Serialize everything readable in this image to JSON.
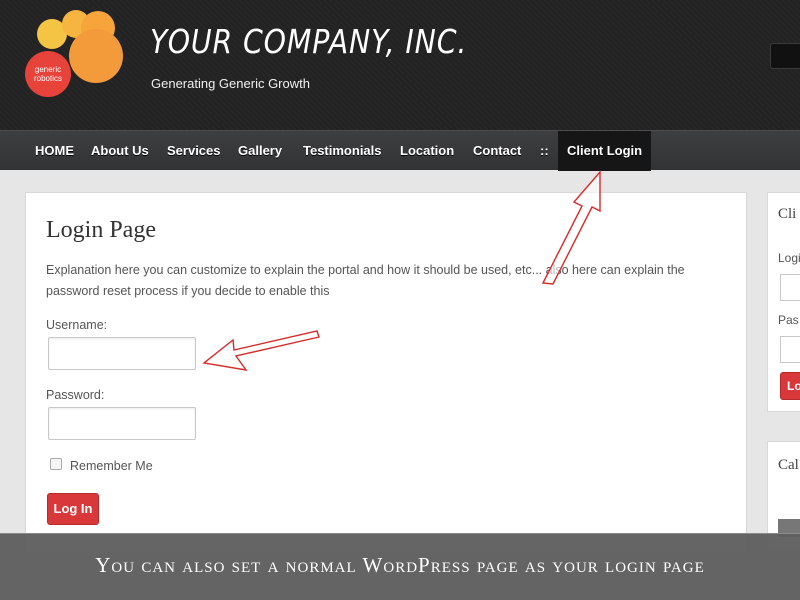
{
  "header": {
    "company_name": "YOUR COMPANY, INC.",
    "tagline": "Generating Generic Growth",
    "logo_text_line1": "generic",
    "logo_text_line2": "robotics"
  },
  "nav": {
    "items": [
      {
        "label": "HOME"
      },
      {
        "label": "About Us"
      },
      {
        "label": "Services"
      },
      {
        "label": "Gallery"
      },
      {
        "label": "Testimonials"
      },
      {
        "label": "Location"
      },
      {
        "label": "Contact"
      },
      {
        "label": "::"
      },
      {
        "label": "Client Login"
      }
    ],
    "active": "Client Login"
  },
  "main": {
    "title": "Login Page",
    "explanation": "Explanation here you can customize to explain the portal and how it should be used, etc... also here can explain the password reset process if you decide to enable this",
    "username_label": "Username:",
    "username_value": "",
    "password_label": "Password:",
    "password_value": "",
    "remember_label": "Remember Me",
    "remember_checked": false,
    "login_button": "Log In"
  },
  "sidebar": {
    "widget1_heading": "Cli",
    "login_label": "Logi",
    "password_label": "Pas",
    "login_button": "Lo",
    "widget2_heading": "Cal"
  },
  "caption": "You can also set a normal WordPress page as your login page",
  "colors": {
    "header_bg": "#222222",
    "nav_bg": "#353739",
    "active_nav_bg": "#161616",
    "button_red": "#d9383a",
    "arrow_red": "#d62b2b",
    "logo_red": "#e8433a",
    "logo_orange": "#f39a3a",
    "logo_yellow": "#f4c445"
  }
}
